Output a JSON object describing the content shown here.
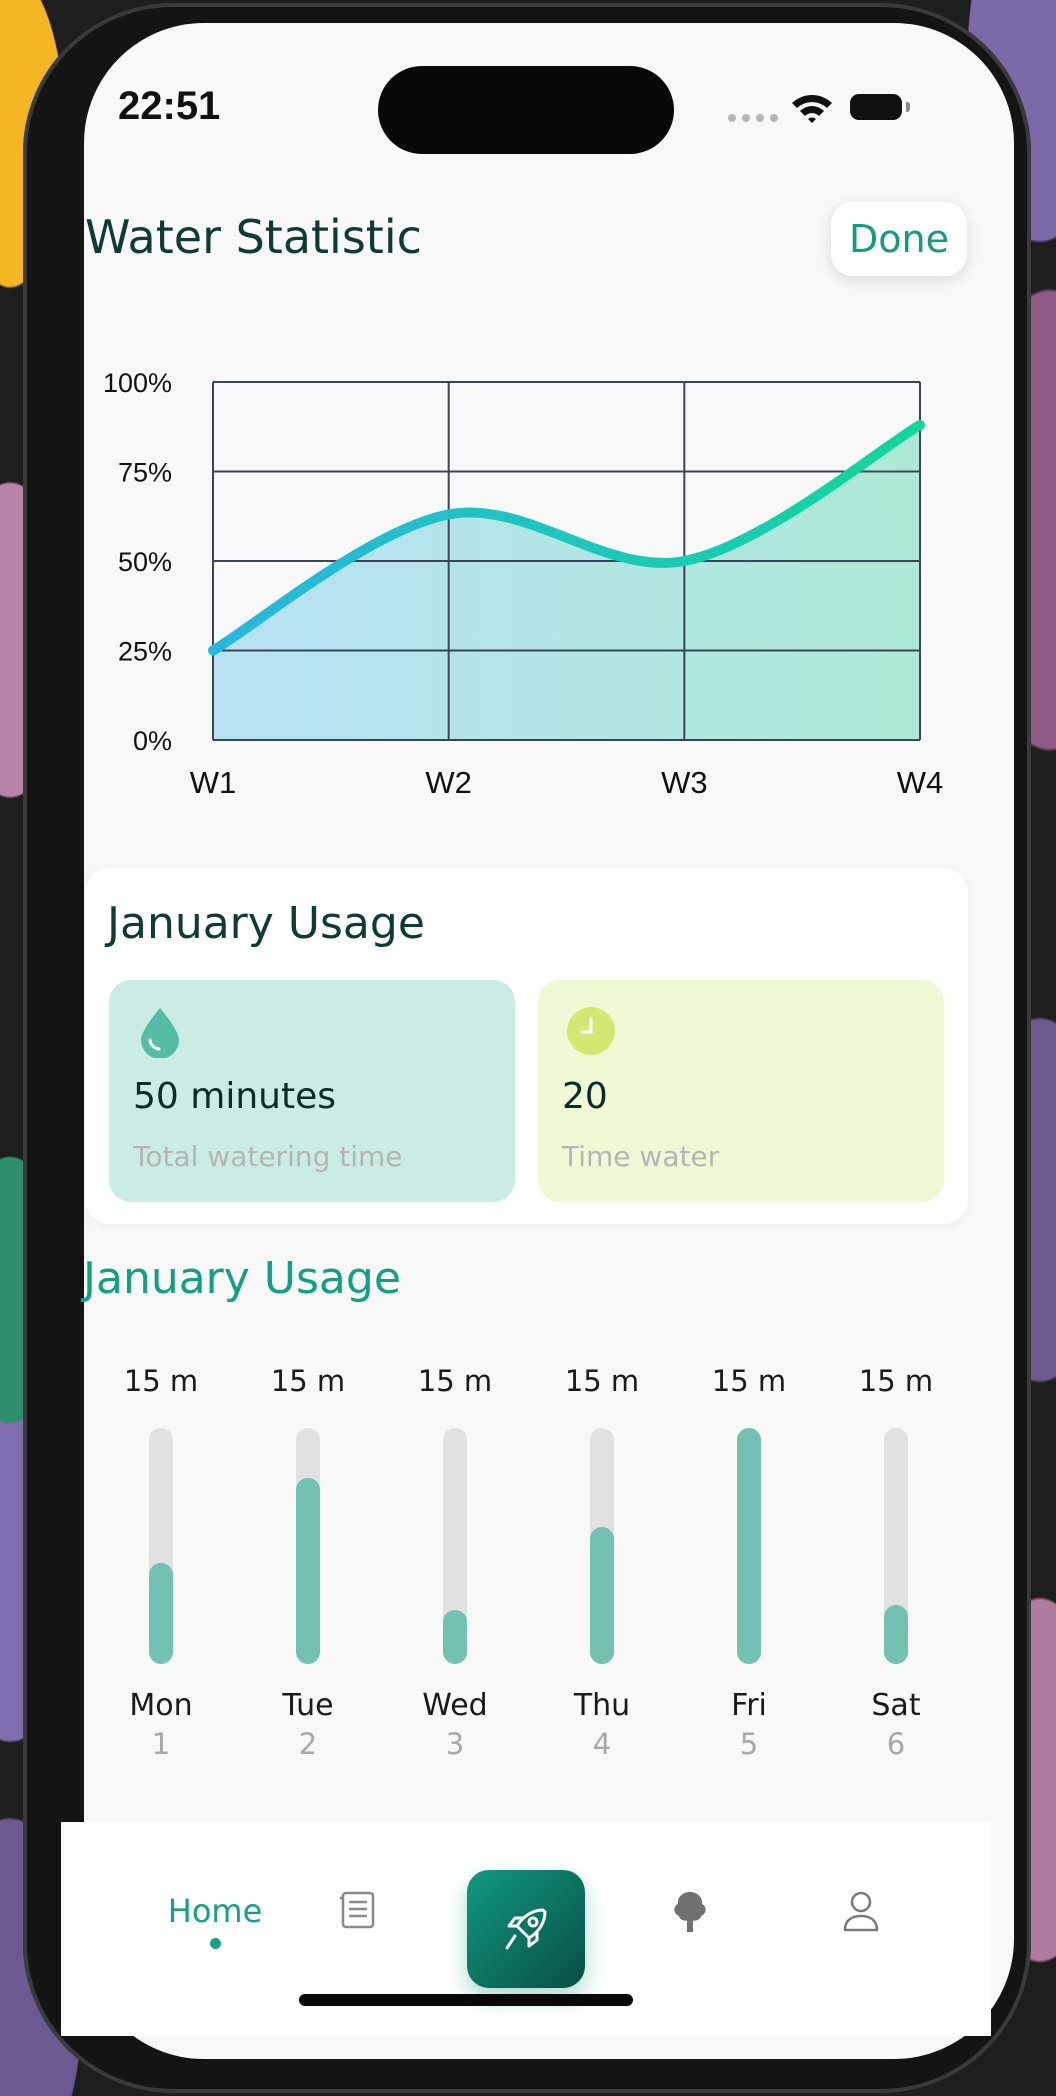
{
  "status_bar": {
    "time": "22:51"
  },
  "header": {
    "title": "Water Statistic",
    "done_label": "Done"
  },
  "colors": {
    "accent": "#14A085",
    "title": "#0F3B35",
    "bar_fill": "#73C1B1",
    "bar_track": "#E1E1E1",
    "line_start": "#29B6DF",
    "line_end": "#12D69A"
  },
  "chart_data": {
    "type": "area",
    "categories": [
      "W1",
      "W2",
      "W3",
      "W4"
    ],
    "series": [
      {
        "values": [
          25,
          63,
          50,
          88
        ]
      }
    ],
    "y_ticks": [
      "0%",
      "25%",
      "50%",
      "75%",
      "100%"
    ],
    "ylim": [
      0,
      100
    ],
    "grid": true,
    "smooth": true
  },
  "usage_card": {
    "title": "January Usage",
    "stats": [
      {
        "icon": "water-drop-icon",
        "value": "50 minutes",
        "label": "Total watering time"
      },
      {
        "icon": "clock-icon",
        "value": "20",
        "label": "Time water"
      }
    ]
  },
  "daily": {
    "title": "January Usage",
    "days": [
      {
        "amount": "15 m",
        "name": "Mon",
        "num": "1",
        "level": 0.43
      },
      {
        "amount": "15 m",
        "name": "Tue",
        "num": "2",
        "level": 0.79
      },
      {
        "amount": "15 m",
        "name": "Wed",
        "num": "3",
        "level": 0.23
      },
      {
        "amount": "15 m",
        "name": "Thu",
        "num": "4",
        "level": 0.58
      },
      {
        "amount": "15 m",
        "name": "Fri",
        "num": "5",
        "level": 1.0
      },
      {
        "amount": "15 m",
        "name": "Sat",
        "num": "6",
        "level": 0.25
      }
    ]
  },
  "tabbar": {
    "items": [
      {
        "label": "Home",
        "icon": "home",
        "active": true
      },
      {
        "icon": "document-icon"
      },
      {
        "icon": "rocket-icon"
      },
      {
        "icon": "tree-icon"
      },
      {
        "icon": "user-icon"
      }
    ]
  }
}
